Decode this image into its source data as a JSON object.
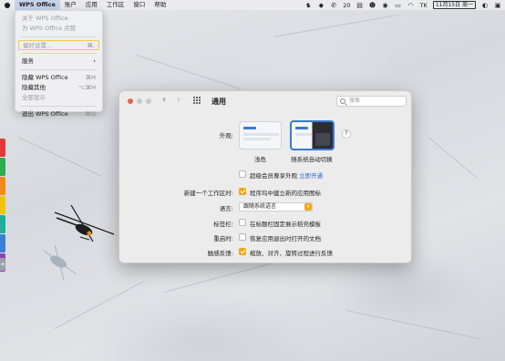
{
  "menubar": {
    "apple_icon": "apple-logo-icon",
    "items": [
      "WPS Office",
      "账户",
      "应用",
      "工作区",
      "窗口",
      "帮助"
    ],
    "tray": {
      "badge_number": "20",
      "input_method": "TK",
      "date_time": "11月15日 周一"
    }
  },
  "app_menu": {
    "about": "关于 WPS Office",
    "rate": "为 WPS Office 点赞",
    "preferences": "偏好设置...",
    "preferences_shortcut": "⌘,",
    "services": "服务",
    "hide_app": "隐藏 WPS Office",
    "hide_app_shortcut": "⌘H",
    "hide_others": "隐藏其他",
    "hide_others_shortcut": "⌥⌘H",
    "show_all": "全部显示",
    "quit": "退出 WPS Office",
    "quit_shortcut": "⌘Q"
  },
  "prefs": {
    "title": "通用",
    "search_placeholder": "搜索",
    "appearance_label": "外观:",
    "appearance_light": "浅色",
    "appearance_auto": "随系统自动切换",
    "help": "?",
    "member_appearance": "超级会员尊享外观",
    "activate_link": "立即开通",
    "new_workspace_label": "新建一个工作区时:",
    "new_workspace_option": "程序坞中建立新的应用图标",
    "language_label": "语言:",
    "language_value": "跟随系统语言",
    "tab_label": "标签栏:",
    "tab_option": "在标题栏固定展示稻壳模板",
    "restart_label": "重启时:",
    "restart_option": "恢复应用退出时打开的文档",
    "touch_label": "触感反馈:",
    "touch_option": "缩放、对齐、旋转过程进行反馈"
  },
  "colors": {
    "accent": "#f0a81b",
    "selection_border": "#3a78d8",
    "link": "#2b66d6"
  }
}
